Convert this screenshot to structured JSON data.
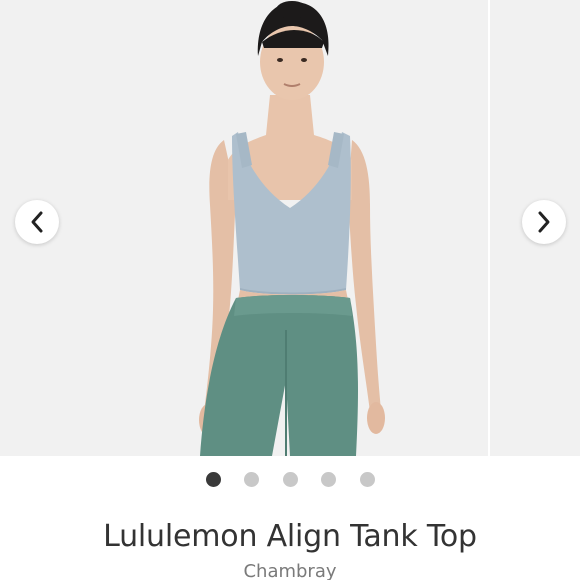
{
  "carousel": {
    "slide_count": 5,
    "active_index": 0,
    "prev_icon": "chevron-left-icon",
    "next_icon": "chevron-right-icon"
  },
  "product": {
    "title": "Lululemon Align Tank Top",
    "color": "Chambray"
  },
  "colors": {
    "dot_active": "#3a3a3a",
    "dot_inactive": "#c8c8c8",
    "title_text": "#333333",
    "subtitle_text": "#7a7a7a"
  }
}
